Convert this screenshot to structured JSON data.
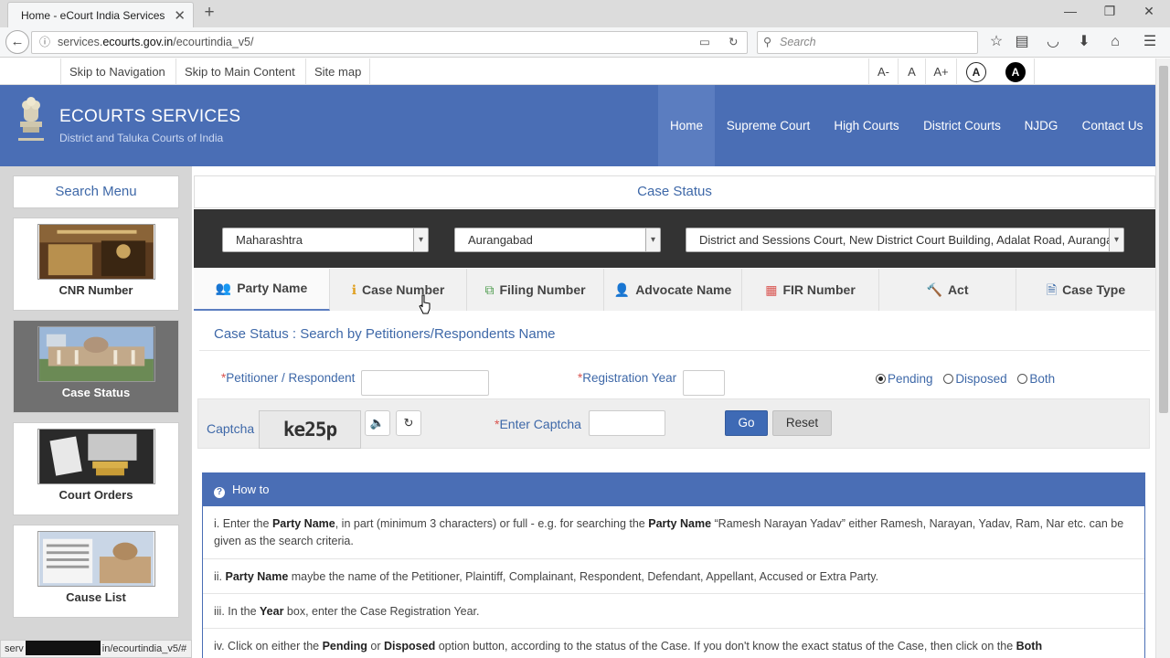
{
  "browser": {
    "tab_title": "Home - eCourt India Services",
    "tab_close": "✕",
    "new_tab": "+",
    "url_prefix": "services.",
    "url_domain": "ecourts.gov.in",
    "url_path": "/ecourtindia_v5/",
    "search_placeholder": "Search",
    "status_url_a": "serv",
    "status_url_b": "in/ecourtindia_v5/#"
  },
  "accessibility": {
    "skip_nav": "Skip to Navigation",
    "skip_main": "Skip to Main Content",
    "sitemap": "Site map",
    "font_smaller": "A-",
    "font_normal": "A",
    "font_larger": "A+",
    "contrast_normal": "A",
    "contrast_high": "A"
  },
  "header": {
    "brand": "ECOURTS SERVICES",
    "tagline": "District and Taluka Courts of India",
    "nav": [
      "Home",
      "Supreme Court",
      "High Courts",
      "District Courts",
      "NJDG",
      "Contact Us"
    ]
  },
  "sidebar": {
    "title": "Search Menu",
    "items": [
      {
        "label": "CNR Number",
        "active": false
      },
      {
        "label": "Case Status",
        "active": true
      },
      {
        "label": "Court Orders",
        "active": false
      },
      {
        "label": "Cause List",
        "active": false
      }
    ]
  },
  "main": {
    "title": "Case Status",
    "state_select": "Maharashtra",
    "district_select": "Aurangabad",
    "court_select": "District and Sessions Court, New District Court Building, Adalat Road, Aurangabad",
    "tabs": [
      {
        "label": "Party Name",
        "icon": "users-icon",
        "glyph": "👥"
      },
      {
        "label": "Case Number",
        "icon": "info-icon",
        "glyph": "ℹ"
      },
      {
        "label": "Filing Number",
        "icon": "copy-icon",
        "glyph": "⧉"
      },
      {
        "label": "Advocate Name",
        "icon": "user-icon",
        "glyph": "👤"
      },
      {
        "label": "FIR Number",
        "icon": "calendar-icon",
        "glyph": "▦"
      },
      {
        "label": "Act",
        "icon": "gavel-icon",
        "glyph": "🔨"
      },
      {
        "label": "Case Type",
        "icon": "document-icon",
        "glyph": "🗎"
      }
    ],
    "subtitle": "Case Status : Search by Petitioners/Respondents Name",
    "form": {
      "petitioner_label": "Petitioner / Respondent",
      "petitioner_value": "",
      "year_label": "Registration Year",
      "year_value": "",
      "status_options": [
        "Pending",
        "Disposed",
        "Both"
      ],
      "status_selected": "Pending",
      "captcha_label": "Captcha",
      "captcha_text": "ke25p",
      "enter_captcha_label": "Enter Captcha",
      "captcha_value": "",
      "go": "Go",
      "reset": "Reset",
      "required_mark": "*"
    },
    "howto": {
      "title": "How to",
      "rows": [
        {
          "a": "i. Enter the ",
          "b1": "Party Name",
          "c": ", in part (minimum 3 characters) or full - e.g. for searching the ",
          "b2": "Party Name",
          "d": " “Ramesh Narayan Yadav” either Ramesh, Narayan, Yadav, Ram, Nar etc. can be given as the search criteria."
        },
        {
          "a": "ii. ",
          "b1": "Party Name",
          "c": " maybe the name of the Petitioner, Plaintiff, Complainant, Respondent, Defendant, Appellant, Accused or Extra Party.",
          "b2": "",
          "d": ""
        },
        {
          "a": "iii. In the ",
          "b1": "Year",
          "c": " box, enter the Case Registration Year.",
          "b2": "",
          "d": ""
        },
        {
          "a": "iv. Click on either the ",
          "b1": "Pending",
          "c": " or ",
          "b2": "Disposed",
          "d": " option button, according to the status of the Case. If you don't know the exact status of the Case, then click on the ",
          "b3": "Both"
        }
      ]
    }
  },
  "colors": {
    "header_blue": "#4a6eb5",
    "link_blue": "#3e68a8",
    "dark_bar": "#333333",
    "go_button": "#3e6ab5"
  }
}
